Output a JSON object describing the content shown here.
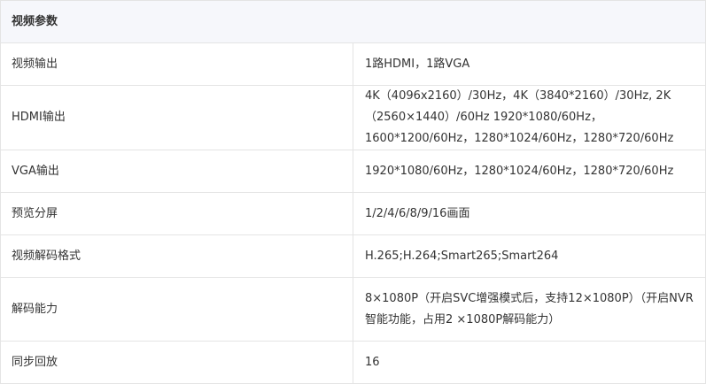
{
  "section": {
    "title": "视频参数"
  },
  "rows": [
    {
      "label": "视频输出",
      "value": "1路HDMI，1路VGA"
    },
    {
      "label": "HDMI输出",
      "value": "4K（4096x2160）/30Hz，4K（3840*2160）/30Hz, 2K（2560×1440）/60Hz 1920*1080/60Hz，1600*1200/60Hz，1280*1024/60Hz，1280*720/60Hz"
    },
    {
      "label": "VGA输出",
      "value": "1920*1080/60Hz，1280*1024/60Hz，1280*720/60Hz"
    },
    {
      "label": "预览分屏",
      "value": "1/2/4/6/8/9/16画面"
    },
    {
      "label": "视频解码格式",
      "value": "H.265;H.264;Smart265;Smart264"
    },
    {
      "label": "解码能力",
      "value": "8×1080P（开启SVC增强模式后，支持12×1080P）（开启NVR智能功能，占用2 ×1080P解码能力）"
    },
    {
      "label": "同步回放",
      "value": "16"
    }
  ]
}
